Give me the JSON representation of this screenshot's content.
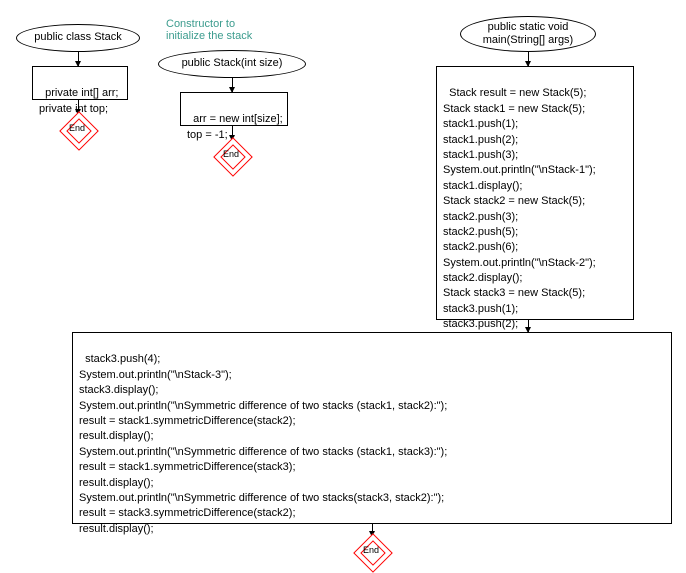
{
  "diagram": {
    "nodes": {
      "class_decl": "public class Stack",
      "fields": "private int[] arr;\nprivate int top;",
      "constructor_decl": "public Stack(int size)",
      "constructor_body": "arr = new int[size];\ntop = -1;",
      "main_decl": "public static void\nmain(String[] args)",
      "main_body1": "Stack result = new Stack(5);\nStack stack1 = new Stack(5);\nstack1.push(1);\nstack1.push(2);\nstack1.push(3);\nSystem.out.println(\"\\nStack-1\");\nstack1.display();\nStack stack2 = new Stack(5);\nstack2.push(3);\nstack2.push(5);\nstack2.push(6);\nSystem.out.println(\"\\nStack-2\");\nstack2.display();\nStack stack3 = new Stack(5);\nstack3.push(1);\nstack3.push(2);",
      "main_body2": "stack3.push(4);\nSystem.out.println(\"\\nStack-3\");\nstack3.display();\nSystem.out.println(\"\\nSymmetric difference of two stacks (stack1, stack2):\");\nresult = stack1.symmetricDifference(stack2);\nresult.display();\nSystem.out.println(\"\\nSymmetric difference of two stacks (stack1, stack3):\");\nresult = stack1.symmetricDifference(stack3);\nresult.display();\nSystem.out.println(\"\\nSymmetric difference of two stacks(stack3, stack2):\");\nresult = stack3.symmetricDifference(stack2);\nresult.display();"
    },
    "comment": "Constructor to\ninitialize the stack",
    "end_label": "End"
  }
}
